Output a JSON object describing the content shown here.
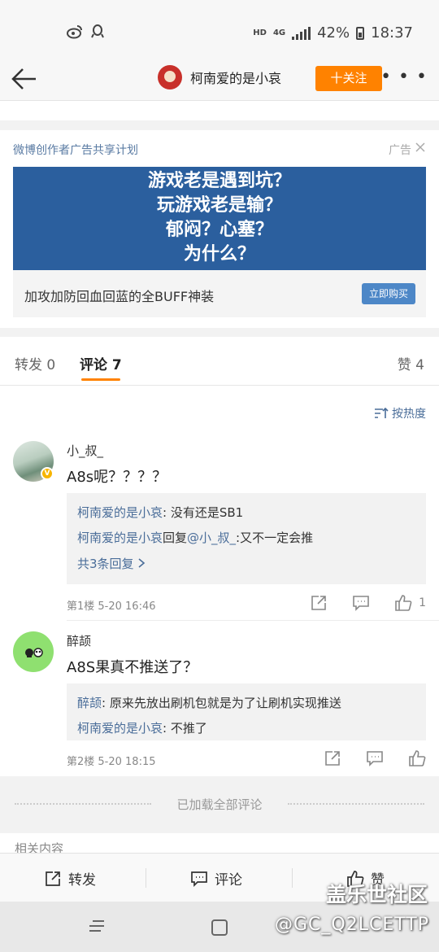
{
  "status_bar": {
    "hd": "HD",
    "network": "4G",
    "battery": "42%",
    "time": "18:37",
    "icons": [
      "weibo-icon",
      "qq-icon",
      "signal-icon",
      "battery-icon"
    ]
  },
  "nav": {
    "user_name": "柯南爱的是小哀",
    "follow_label": "十关注",
    "more_label": "• • •"
  },
  "ad": {
    "header": "微博创作者广告共享计划",
    "close_label": "广告",
    "banner_lines": [
      "游戏老是遇到坑？",
      "玩游戏老是输？",
      "郁闷？心塞？",
      "为什么？"
    ],
    "description": "加攻加防回血回蓝的全BUFF神装",
    "buy_label": "立即购买"
  },
  "tabs": {
    "repost": "转发 0",
    "comment": "评论 7",
    "like": "赞 4"
  },
  "sort_label": "按热度",
  "comments": [
    {
      "name": "小_叔_",
      "text": "A8s呢？？？？",
      "replies": [
        {
          "user": "柯南爱的是小哀",
          "text": ": 没有还是SB1"
        },
        {
          "user": "柯南爱的是小哀",
          "mid": "回复",
          "mention": "@小_叔_",
          "text": ":又不一定会推"
        }
      ],
      "more_replies": "共3条回复",
      "meta": "第1楼  5-20 16:46",
      "likes": "1"
    },
    {
      "name": "醉颉",
      "text": "A8S果真不推送了？",
      "replies": [
        {
          "user": "醉颉",
          "text": ": 原来先放出刷机包就是为了让刷机实现推送"
        },
        {
          "user": "柯南爱的是小哀",
          "text": ": 不推了"
        }
      ],
      "meta": "第2楼  5-20 18:15",
      "likes": ""
    }
  ],
  "loaded_all": "已加载全部评论",
  "related_label": "相关内容",
  "toolbar": {
    "repost": "转发",
    "comment": "评论",
    "like": "赞"
  },
  "watermark": {
    "line1": "盖乐世社区",
    "line2": "@GC_Q2LCETTP"
  }
}
